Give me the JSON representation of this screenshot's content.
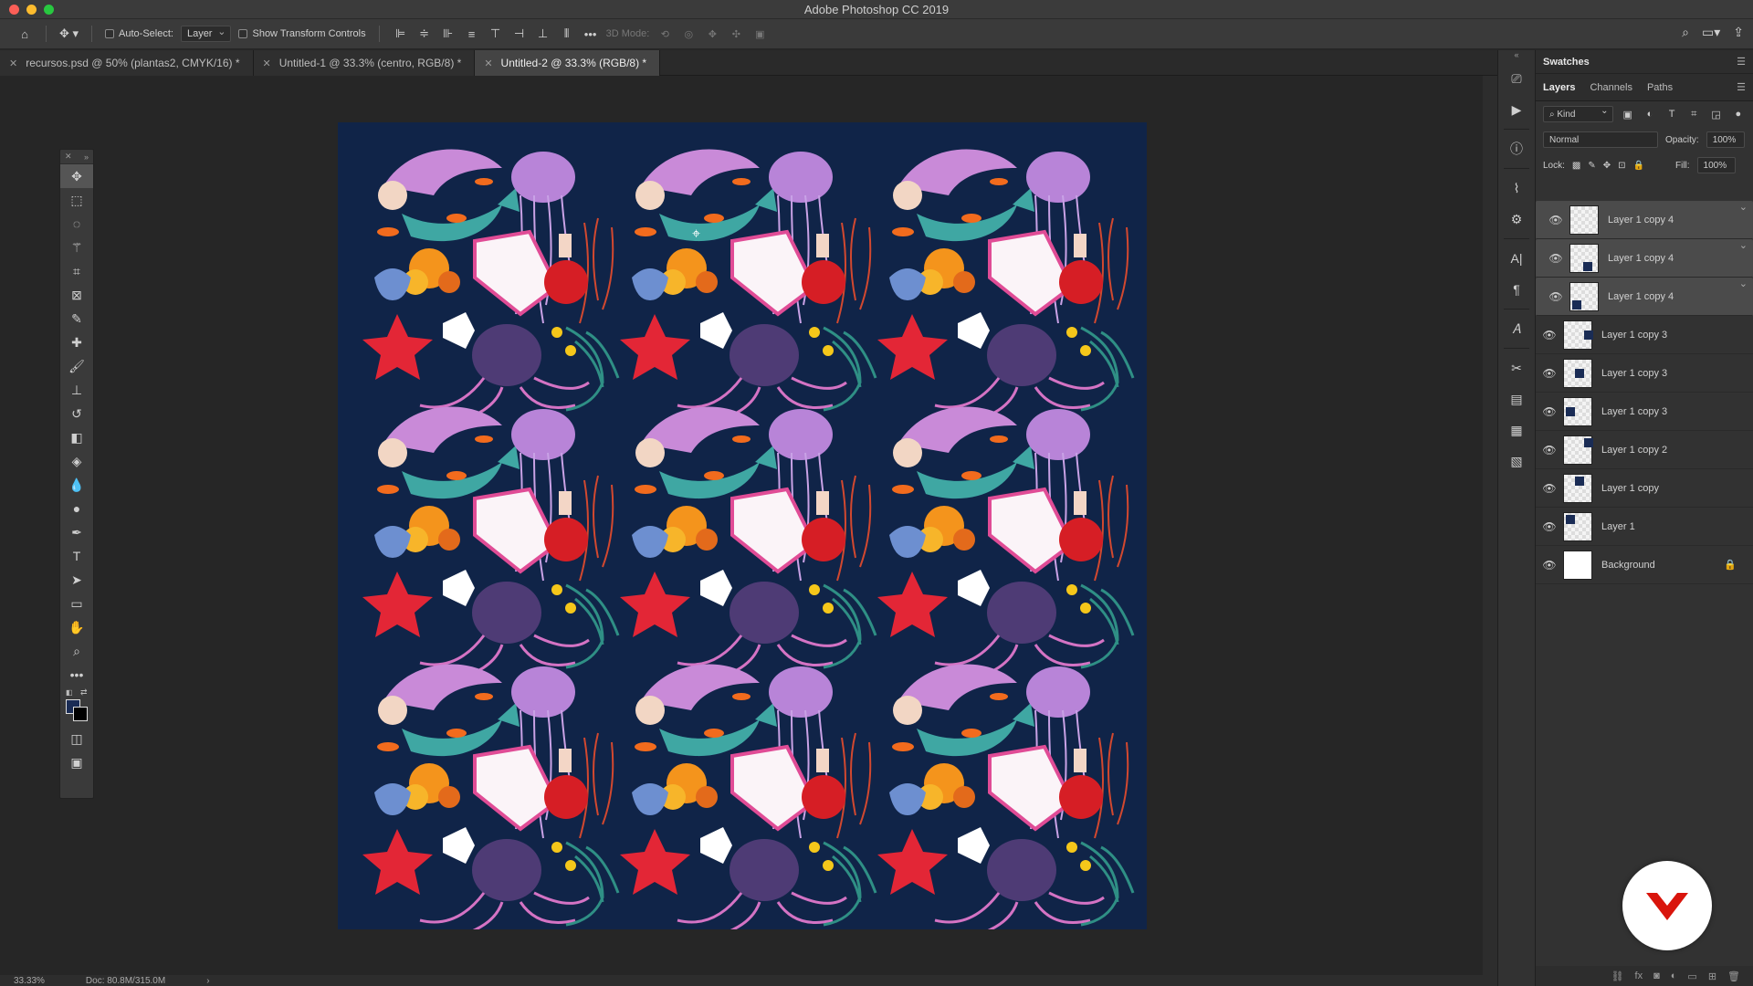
{
  "window": {
    "title": "Adobe Photoshop CC 2019"
  },
  "options_bar": {
    "auto_select_label": "Auto-Select:",
    "auto_select_value": "Layer",
    "transform_label": "Show Transform Controls",
    "mode_label": "3D Mode:"
  },
  "tabs": [
    {
      "label": "recursos.psd @ 50% (plantas2, CMYK/16) *"
    },
    {
      "label": "Untitled-1 @ 33.3% (centro, RGB/8) *"
    },
    {
      "label": "Untitled-2 @ 33.3% (RGB/8) *"
    }
  ],
  "status": {
    "zoom": "33.33%",
    "doc": "Doc: 80.8M/315.0M",
    "arrow": "›"
  },
  "panels": {
    "swatches_title": "Swatches",
    "tabs": [
      "Layers",
      "Channels",
      "Paths"
    ],
    "kind": "Kind",
    "blend_mode": "Normal",
    "opacity_label": "Opacity:",
    "opacity": "100%",
    "lock_label": "Lock:",
    "fill_label": "Fill:",
    "fill": "100%"
  },
  "layers": [
    {
      "name": "Layer 1 copy 4",
      "selected": true
    },
    {
      "name": "Layer 1 copy 4",
      "selected": true
    },
    {
      "name": "Layer 1 copy 4",
      "selected": true
    },
    {
      "name": "Layer 1 copy 3",
      "selected": false
    },
    {
      "name": "Layer 1 copy 3",
      "selected": false
    },
    {
      "name": "Layer 1 copy 3",
      "selected": false
    },
    {
      "name": "Layer 1 copy 2",
      "selected": false
    },
    {
      "name": "Layer 1 copy",
      "selected": false
    },
    {
      "name": "Layer 1",
      "selected": false
    },
    {
      "name": "Background",
      "selected": false,
      "locked": true
    }
  ],
  "colors": {
    "canvas_bg": "#102448",
    "foreground": "#1a2c55",
    "background": "#000000",
    "accent_logo": "#d9150c"
  },
  "tools": [
    "move-icon",
    "marquee-icon",
    "lasso-icon",
    "magic-wand-icon",
    "crop-icon",
    "frame-icon",
    "eyedropper-icon",
    "healing-icon",
    "brush-icon",
    "stamp-icon",
    "history-brush-icon",
    "eraser-icon",
    "bucket-icon",
    "blur-icon",
    "dodge-icon",
    "pen-icon",
    "type-icon",
    "path-select-icon",
    "rectangle-icon",
    "hand-icon",
    "zoom-icon",
    "more-icon"
  ]
}
